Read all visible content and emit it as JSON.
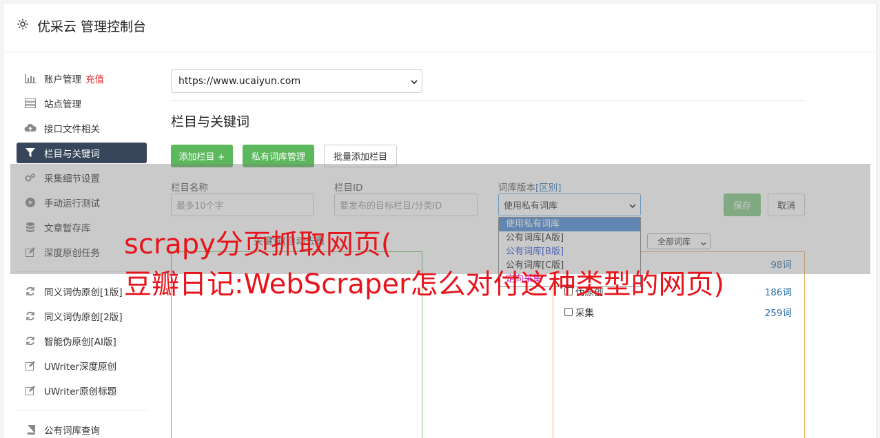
{
  "header": {
    "title": "优采云 管理控制台",
    "icon": "gear-icon"
  },
  "sidebar": {
    "items": [
      {
        "label": "账户管理",
        "badge": "充值",
        "icon": "bar-chart-icon"
      },
      {
        "label": "站点管理",
        "icon": "server-icon"
      },
      {
        "label": "接口文件相关",
        "icon": "cloud-upload-icon"
      },
      {
        "label": "栏目与关键词",
        "icon": "filter-icon",
        "active": true
      },
      {
        "label": "采集细节设置",
        "icon": "cogs-icon"
      },
      {
        "label": "手动运行测试",
        "icon": "play-circle-icon"
      },
      {
        "label": "文章暂存库",
        "icon": "database-icon"
      },
      {
        "label": "深度原创任务",
        "icon": "edit-icon"
      },
      {
        "label": "同义词伪原创[1版]",
        "icon": "refresh-icon"
      },
      {
        "label": "同义词伪原创[2版]",
        "icon": "refresh-icon"
      },
      {
        "label": "智能伪原创[AI版]",
        "icon": "refresh-icon"
      },
      {
        "label": "UWriter深度原创",
        "icon": "edit-icon"
      },
      {
        "label": "UWriter原创标题",
        "icon": "edit-icon"
      },
      {
        "label": "公有词库查询",
        "icon": "book-icon"
      }
    ]
  },
  "main": {
    "site_select": "https://www.ucaiyun.com",
    "section_title": "栏目与关键词",
    "buttons": {
      "add_column": "添加栏目 +",
      "private_lib": "私有词库管理",
      "batch_add": "批量添加栏目"
    },
    "form": {
      "col_name_label": "栏目名称",
      "col_name_placeholder": "最多10个字",
      "col_id_label": "栏目ID",
      "col_id_placeholder": "要发布的目标栏目/分类ID",
      "lib_version_label": "词库版本",
      "lib_version_link": "[区别]",
      "lib_version_value": "使用私有词库",
      "save": "保存",
      "cancel": "取消"
    },
    "dropdown_options": [
      "使用私有词库",
      "公有词库[A版]",
      "公有词库[B版]",
      "公有词库[C版]",
      "定向采集"
    ],
    "green_box_label": "关键词(自动去重",
    "all_libs_select": "全部词库",
    "libraries": [
      {
        "name": "",
        "count": "98词"
      },
      {
        "name": "伪原创",
        "count": "186词"
      },
      {
        "name": "采集",
        "count": "259词"
      }
    ]
  },
  "watermark": {
    "line1": "scrapy分页抓取网页(",
    "line2": "豆瓣日记:WebScraper怎么对付这种类型的网页)"
  },
  "colors": {
    "active_nav": "#37465a",
    "green": "#5cb85c",
    "watermark": "#e8141c"
  }
}
